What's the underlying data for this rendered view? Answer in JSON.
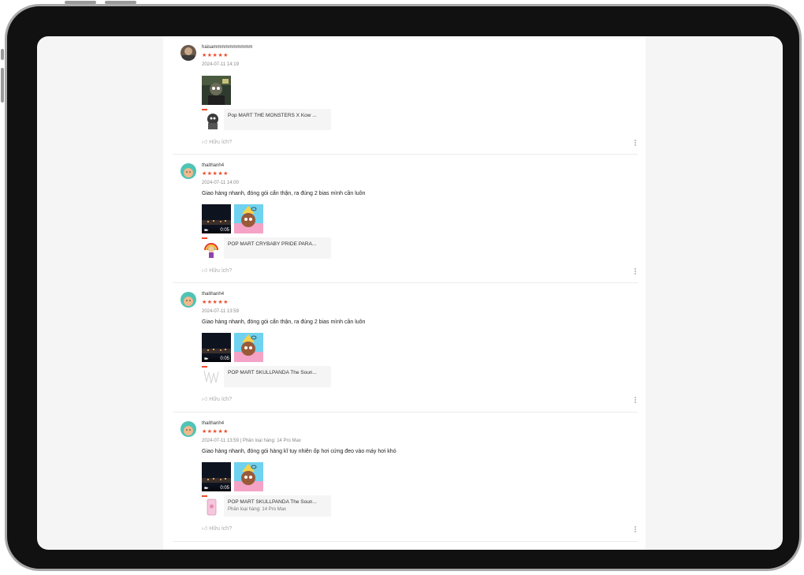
{
  "reviews": [
    {
      "username": "haisammmmmmmmmm",
      "stars": "★★★★★",
      "meta": "2024-07-11 14:19",
      "comment": "",
      "media": [
        {
          "kind": "image"
        }
      ],
      "product": {
        "name": "Pop MART THE MONSTERS X Kow ...",
        "variant": ""
      },
      "helpful_label": "Hữu ích?"
    },
    {
      "username": "thaithanh4",
      "stars": "★★★★★",
      "meta": "2024-07-11 14:00",
      "comment": "Giao hàng nhanh, đóng gói cẩn thận, ra đúng 2 bias mình cần luôn",
      "media": [
        {
          "kind": "video",
          "duration": "0:05"
        },
        {
          "kind": "image"
        }
      ],
      "product": {
        "name": "POP MART CRYBABY PRIDE PARA...",
        "variant": ""
      },
      "helpful_label": "Hữu ích?"
    },
    {
      "username": "thaithanh4",
      "stars": "★★★★★",
      "meta": "2024-07-11 13:59",
      "comment": "Giao hàng nhanh, đóng gói cẩn thận, ra đúng 2 bias mình cần luôn",
      "media": [
        {
          "kind": "video",
          "duration": "0:05"
        },
        {
          "kind": "image"
        }
      ],
      "product": {
        "name": "POP MART SKULLPANDA The Soun...",
        "variant": ""
      },
      "helpful_label": "Hữu ích?"
    },
    {
      "username": "thaithanh4",
      "stars": "★★★★★",
      "meta": "2024-07-11 13:59 | Phân loại hàng: 14 Pro Max",
      "comment": "Giao hàng nhanh, đóng gói hàng kĩ tuy nhiên ốp hơi cứng đeo vào máy hơi khó",
      "media": [
        {
          "kind": "video",
          "duration": "0:05"
        },
        {
          "kind": "image"
        }
      ],
      "product": {
        "name": "POP MART SKULLPANDA The Soun...",
        "variant": "Phân loại hàng: 14 Pro Max"
      },
      "helpful_label": "Hữu ích?"
    }
  ],
  "icons": {
    "thumb_up": "thumbs-up-icon",
    "more": "more-vertical-icon",
    "video": "video-camera-icon"
  },
  "colors": {
    "star": "#ee4d2d",
    "helpful": "#aaaaaa",
    "avatar_teal": "#4fc3b6"
  }
}
